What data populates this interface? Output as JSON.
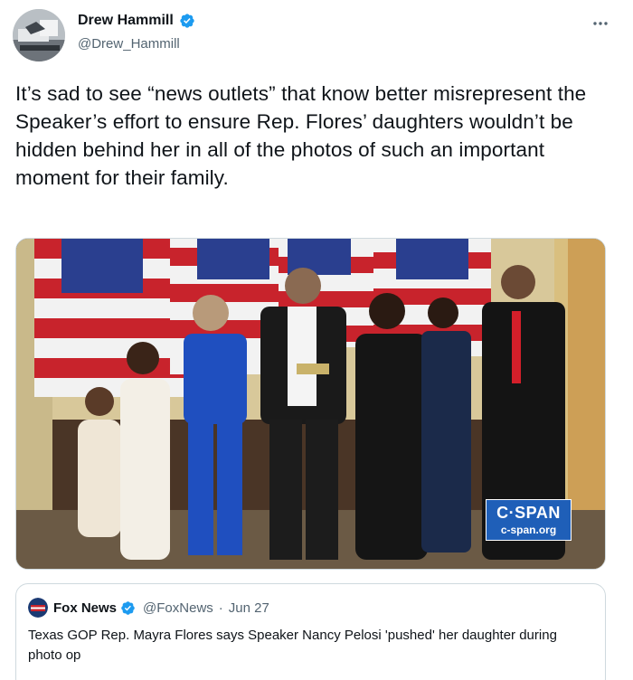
{
  "author": {
    "display_name": "Drew Hammill",
    "handle": "@Drew_Hammill",
    "verified_icon": "verified-badge-icon",
    "avatar_icon": "profile-photo"
  },
  "tweet": {
    "text": "It’s sad to see “news outlets” that know better misrepresent the Speaker’s effort to ensure Rep. Flores’ daughters wouldn’t be hidden behind her in all of the photos of such an important moment for their family."
  },
  "media": {
    "watermark_logo": "C·SPAN",
    "watermark_url": "c-span.org"
  },
  "quoted_tweet": {
    "display_name": "Fox News",
    "handle": "@FoxNews",
    "separator": "·",
    "date": "Jun 27",
    "text": "Texas GOP Rep. Mayra Flores says Speaker Nancy Pelosi 'pushed' her daughter during photo op"
  },
  "colors": {
    "verified_blue": "#1d9bf0",
    "secondary_text": "#536471",
    "cspan_blue": "#1f5fb8"
  }
}
